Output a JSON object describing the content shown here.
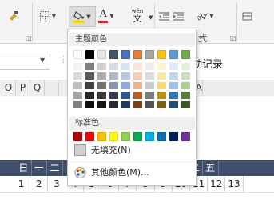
{
  "ribbon": {
    "font_sample_label": "A",
    "wen_label": "wén",
    "wen_char": "文",
    "group_label_right": "式",
    "colors": {
      "font_underline": "#d32a2a",
      "fill_underline": "#ffd400"
    }
  },
  "formula_bar": {
    "cell_text": "勤记录"
  },
  "column_headers": [
    "O",
    "P",
    "Q",
    "",
    "",
    "",
    "",
    "",
    "",
    "",
    "",
    "Y",
    "Z",
    "AA"
  ],
  "weekday_row": [
    "日",
    "一",
    "二",
    "",
    "",
    "",
    "",
    "",
    "",
    "",
    "三",
    "二",
    "五"
  ],
  "number_row": [
    "1",
    "2",
    "3",
    "4",
    "5",
    "6",
    "7",
    "8",
    "9",
    "10",
    "11",
    "12",
    "13"
  ],
  "picker": {
    "theme_title": "主题颜色",
    "standard_title": "标准色",
    "no_fill_label": "无填充(N)",
    "more_colors_label": "其他颜色(M)...",
    "theme_colors": [
      "#ffffff",
      "#000000",
      "#e7e6e6",
      "#44546a",
      "#4472c4",
      "#ed7d31",
      "#a5a5a5",
      "#ffc000",
      "#5b9bd5",
      "#70ad47"
    ],
    "theme_shades": [
      [
        "#f2f2f2",
        "#d9d9d9",
        "#bfbfbf",
        "#a6a6a6",
        "#808080"
      ],
      [
        "#7f7f7f",
        "#595959",
        "#404040",
        "#262626",
        "#0d0d0d"
      ],
      [
        "#d0cece",
        "#afabab",
        "#757171",
        "#3a3838",
        "#171616"
      ],
      [
        "#d6dce5",
        "#adb9ca",
        "#8497b0",
        "#333f50",
        "#222a35"
      ],
      [
        "#d9e2f3",
        "#b4c7e7",
        "#8faadc",
        "#2f5597",
        "#1f3864"
      ],
      [
        "#fbe5d6",
        "#f8cbad",
        "#f4b183",
        "#c55a11",
        "#843c0c"
      ],
      [
        "#ededed",
        "#dbdbdb",
        "#c9c9c9",
        "#7b7b7b",
        "#525252"
      ],
      [
        "#fff2cc",
        "#ffe699",
        "#ffd966",
        "#bf9000",
        "#7f6000"
      ],
      [
        "#deebf7",
        "#bdd7ee",
        "#9dc3e6",
        "#2e75b6",
        "#1f4e79"
      ],
      [
        "#e2f0d9",
        "#c5e0b4",
        "#a9d18e",
        "#548235",
        "#385723"
      ]
    ],
    "standard_colors": [
      "#c00000",
      "#ff0000",
      "#ffc000",
      "#ffff00",
      "#92d050",
      "#00b050",
      "#00b0f0",
      "#0070c0",
      "#002060",
      "#7030a0"
    ],
    "no_fill_swatch": "#d0d0d0"
  }
}
